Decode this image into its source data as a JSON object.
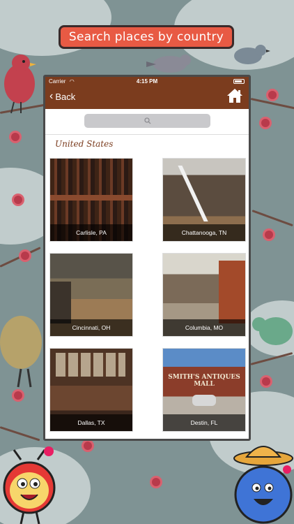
{
  "banner": {
    "text": "Search places by country"
  },
  "status_bar": {
    "carrier": "Carrier",
    "time": "4:15 PM"
  },
  "nav": {
    "back_label": "Back",
    "home_icon": "home-icon"
  },
  "search": {
    "placeholder": "",
    "icon": "search-icon"
  },
  "section": {
    "title": "United States"
  },
  "places": [
    {
      "name": "Carlisle, PA"
    },
    {
      "name": "Chattanooga, TN"
    },
    {
      "name": "Cincinnati, OH"
    },
    {
      "name": "Columbia, MO"
    },
    {
      "name": "Dallas, TX"
    },
    {
      "name": "Destin, FL"
    }
  ],
  "destin_sign": "SMITH'S ANTIQUES MALL",
  "colors": {
    "nav": "#7b3c1e",
    "banner": "#e85a44",
    "section_title": "#7b3c1e"
  }
}
